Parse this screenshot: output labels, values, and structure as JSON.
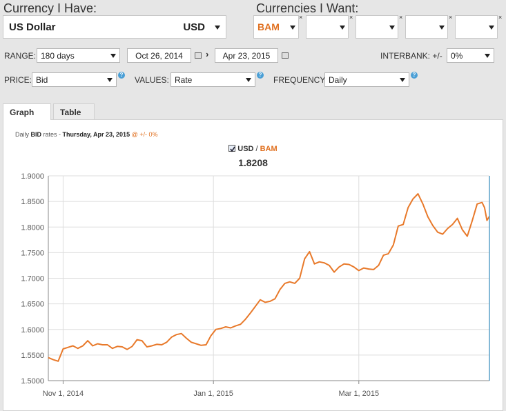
{
  "have": {
    "title": "Currency I Have:",
    "currency_name": "US Dollar",
    "currency_code": "USD"
  },
  "want": {
    "title": "Currencies I Want:",
    "slots": [
      "BAM",
      "",
      "",
      "",
      ""
    ],
    "remove_mark": "×"
  },
  "controls": {
    "range_label": "RANGE:",
    "range_value": "180 days",
    "start_date": "Oct 26, 2014",
    "date_sep": "›",
    "end_date": "Apr 23, 2015",
    "interbank_label": "INTERBANK: +/-",
    "interbank_value": "0%",
    "price_label": "PRICE:",
    "price_value": "Bid",
    "values_label": "VALUES:",
    "values_value": "Rate",
    "frequency_label": "FREQUENCY:",
    "frequency_value": "Daily",
    "help_mark": "?"
  },
  "tabs": [
    {
      "label": "Graph",
      "active": true
    },
    {
      "label": "Table",
      "active": false
    }
  ],
  "subtitle": {
    "prefix": "Daily ",
    "price": "BID",
    "mid": " rates - ",
    "date": "Thursday, Apr 23, 2015",
    "suffix": " @ +/- 0%"
  },
  "legend": {
    "base": "USD",
    "slash": " / ",
    "quote": "BAM",
    "current_value": "1.8208"
  },
  "colors": {
    "line": "#e8792a",
    "accent": "#e07020",
    "grid": "#dddddd",
    "axis": "#888888",
    "cursor": "#5aa0c8"
  },
  "chart_data": {
    "type": "line",
    "title": "",
    "xlabel": "",
    "ylabel": "",
    "ylim": [
      1.5,
      1.9
    ],
    "xlim": [
      "2014-10-26",
      "2015-04-23"
    ],
    "yticks": [
      "1.9000",
      "1.8500",
      "1.8000",
      "1.7500",
      "1.7000",
      "1.6500",
      "1.6000",
      "1.5500",
      "1.5000"
    ],
    "xticks": [
      {
        "date": "2014-11-01",
        "label": "Nov 1, 2014"
      },
      {
        "date": "2015-01-01",
        "label": "Jan 1, 2015"
      },
      {
        "date": "2015-03-01",
        "label": "Mar 1, 2015"
      }
    ],
    "series": [
      {
        "name": "USD / BAM",
        "points": [
          [
            "2014-10-26",
            1.545
          ],
          [
            "2014-10-28",
            1.541
          ],
          [
            "2014-10-30",
            1.538
          ],
          [
            "2014-11-01",
            1.562
          ],
          [
            "2014-11-03",
            1.565
          ],
          [
            "2014-11-05",
            1.568
          ],
          [
            "2014-11-07",
            1.563
          ],
          [
            "2014-11-09",
            1.568
          ],
          [
            "2014-11-11",
            1.578
          ],
          [
            "2014-11-13",
            1.568
          ],
          [
            "2014-11-15",
            1.572
          ],
          [
            "2014-11-17",
            1.57
          ],
          [
            "2014-11-19",
            1.57
          ],
          [
            "2014-11-21",
            1.563
          ],
          [
            "2014-11-23",
            1.567
          ],
          [
            "2014-11-25",
            1.566
          ],
          [
            "2014-11-27",
            1.561
          ],
          [
            "2014-11-29",
            1.567
          ],
          [
            "2014-12-01",
            1.58
          ],
          [
            "2014-12-03",
            1.578
          ],
          [
            "2014-12-05",
            1.566
          ],
          [
            "2014-12-07",
            1.568
          ],
          [
            "2014-12-09",
            1.571
          ],
          [
            "2014-12-11",
            1.57
          ],
          [
            "2014-12-13",
            1.575
          ],
          [
            "2014-12-15",
            1.585
          ],
          [
            "2014-12-17",
            1.59
          ],
          [
            "2014-12-19",
            1.592
          ],
          [
            "2014-12-21",
            1.583
          ],
          [
            "2014-12-23",
            1.575
          ],
          [
            "2014-12-25",
            1.572
          ],
          [
            "2014-12-27",
            1.569
          ],
          [
            "2014-12-29",
            1.57
          ],
          [
            "2014-12-31",
            1.588
          ],
          [
            "2015-01-02",
            1.6
          ],
          [
            "2015-01-04",
            1.602
          ],
          [
            "2015-01-06",
            1.605
          ],
          [
            "2015-01-08",
            1.603
          ],
          [
            "2015-01-10",
            1.607
          ],
          [
            "2015-01-12",
            1.61
          ],
          [
            "2015-01-14",
            1.62
          ],
          [
            "2015-01-16",
            1.632
          ],
          [
            "2015-01-18",
            1.645
          ],
          [
            "2015-01-20",
            1.658
          ],
          [
            "2015-01-22",
            1.653
          ],
          [
            "2015-01-24",
            1.655
          ],
          [
            "2015-01-26",
            1.66
          ],
          [
            "2015-01-28",
            1.678
          ],
          [
            "2015-01-30",
            1.69
          ],
          [
            "2015-02-01",
            1.693
          ],
          [
            "2015-02-03",
            1.69
          ],
          [
            "2015-02-05",
            1.7
          ],
          [
            "2015-02-07",
            1.738
          ],
          [
            "2015-02-09",
            1.752
          ],
          [
            "2015-02-11",
            1.728
          ],
          [
            "2015-02-13",
            1.732
          ],
          [
            "2015-02-15",
            1.73
          ],
          [
            "2015-02-17",
            1.725
          ],
          [
            "2015-02-19",
            1.712
          ],
          [
            "2015-02-21",
            1.722
          ],
          [
            "2015-02-23",
            1.728
          ],
          [
            "2015-02-25",
            1.727
          ],
          [
            "2015-02-27",
            1.722
          ],
          [
            "2015-03-01",
            1.715
          ],
          [
            "2015-03-03",
            1.72
          ],
          [
            "2015-03-05",
            1.718
          ],
          [
            "2015-03-07",
            1.717
          ],
          [
            "2015-03-09",
            1.725
          ],
          [
            "2015-03-11",
            1.745
          ],
          [
            "2015-03-13",
            1.748
          ],
          [
            "2015-03-15",
            1.765
          ],
          [
            "2015-03-17",
            1.802
          ],
          [
            "2015-03-19",
            1.805
          ],
          [
            "2015-03-21",
            1.838
          ],
          [
            "2015-03-23",
            1.855
          ],
          [
            "2015-03-25",
            1.865
          ],
          [
            "2015-03-27",
            1.845
          ],
          [
            "2015-03-29",
            1.82
          ],
          [
            "2015-03-31",
            1.803
          ],
          [
            "2015-04-02",
            1.79
          ],
          [
            "2015-04-04",
            1.786
          ],
          [
            "2015-04-06",
            1.797
          ],
          [
            "2015-04-08",
            1.805
          ],
          [
            "2015-04-10",
            1.817
          ],
          [
            "2015-04-12",
            1.795
          ],
          [
            "2015-04-14",
            1.782
          ],
          [
            "2015-04-16",
            1.812
          ],
          [
            "2015-04-18",
            1.845
          ],
          [
            "2015-04-20",
            1.848
          ],
          [
            "2015-04-21",
            1.838
          ],
          [
            "2015-04-22",
            1.813
          ],
          [
            "2015-04-23",
            1.821
          ]
        ]
      }
    ],
    "grid": true,
    "legend": "top-center"
  }
}
